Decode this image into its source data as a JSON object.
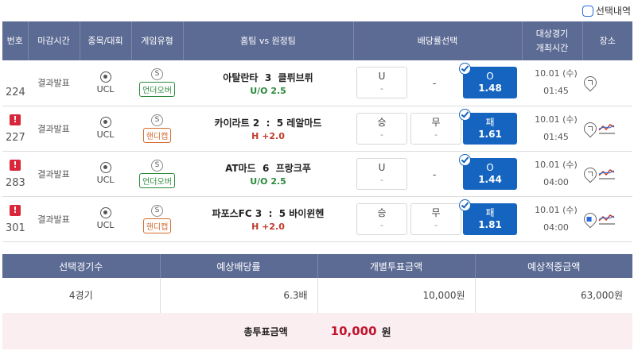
{
  "toolbar": {
    "select_history_label": "선택내역"
  },
  "headers": {
    "no": "번호",
    "deadline": "마감시간",
    "sport": "종목/대회",
    "game_type": "게임유형",
    "teams": "홈팀 vs 원정팀",
    "odds_select": "배당률선택",
    "datetime_line1": "대상경기",
    "datetime_line2": "개최시간",
    "venue": "장소"
  },
  "rows": [
    {
      "no": "224",
      "alert": false,
      "deadline": "결과발표",
      "sport": "UCL",
      "game_type_badge": "S",
      "game_type": "언더오버",
      "game_type_kind": "ou",
      "home": "아탈란타",
      "score": "3",
      "away": "클뤼브뤼",
      "handicap": "U/O 2.5",
      "handicap_kind": "ou",
      "odds": [
        {
          "label": "U",
          "sub": "-",
          "selected": false
        },
        {
          "label": "-",
          "sub": "",
          "selected": false
        },
        {
          "label": "O",
          "sub": "1.48",
          "selected": true
        }
      ],
      "date": "10.01 (수)",
      "time": "01:45",
      "venue_icon": "map-pin-icon",
      "trend": false
    },
    {
      "no": "227",
      "alert": true,
      "deadline": "결과발표",
      "sport": "UCL",
      "game_type_badge": "S",
      "game_type": "핸디캡",
      "game_type_kind": "hc",
      "home": "카이라트 2",
      "score": ":",
      "away": "5 레알마드",
      "handicap": "H +2.0",
      "handicap_kind": "hc",
      "odds": [
        {
          "label": "승",
          "sub": "-",
          "selected": false
        },
        {
          "label": "무",
          "sub": "-",
          "selected": false
        },
        {
          "label": "패",
          "sub": "1.61",
          "selected": true
        }
      ],
      "date": "10.01 (수)",
      "time": "01:45",
      "venue_icon": "map-pin-icon",
      "trend": true
    },
    {
      "no": "283",
      "alert": true,
      "deadline": "결과발표",
      "sport": "UCL",
      "game_type_badge": "S",
      "game_type": "언더오버",
      "game_type_kind": "ou",
      "home": "AT마드",
      "score": "6",
      "away": "프랑크푸",
      "handicap": "U/O 2.5",
      "handicap_kind": "ou",
      "odds": [
        {
          "label": "U",
          "sub": "-",
          "selected": false
        },
        {
          "label": "-",
          "sub": "",
          "selected": false
        },
        {
          "label": "O",
          "sub": "1.44",
          "selected": true
        }
      ],
      "date": "10.01 (수)",
      "time": "04:00",
      "venue_icon": "map-pin-icon",
      "trend": true
    },
    {
      "no": "301",
      "alert": true,
      "deadline": "결과발표",
      "sport": "UCL",
      "game_type_badge": "S",
      "game_type": "핸디캡",
      "game_type_kind": "hc",
      "home": "파포스FC 3",
      "score": ":",
      "away": "5 바이윈헨",
      "handicap": "H +2.0",
      "handicap_kind": "hc",
      "odds": [
        {
          "label": "승",
          "sub": "-",
          "selected": false
        },
        {
          "label": "무",
          "sub": "-",
          "selected": false
        },
        {
          "label": "패",
          "sub": "1.81",
          "selected": true
        }
      ],
      "date": "10.01 (수)",
      "time": "04:00",
      "venue_icon": "map-pin-star-icon",
      "trend": true
    }
  ],
  "summary": {
    "headers": [
      "선택경기수",
      "예상배당률",
      "개별투표금액",
      "예상적중금액"
    ],
    "values": [
      "4경기",
      "6.3배",
      "10,000원",
      "63,000원"
    ]
  },
  "total": {
    "label": "총투표금액",
    "value": "10,000",
    "unit": "원"
  },
  "colors": {
    "header_bg": "#5c6b94",
    "selected_odds": "#1565c0",
    "alert": "#d9263a",
    "total_value": "#c0142e",
    "total_bg": "#fbeef1"
  }
}
